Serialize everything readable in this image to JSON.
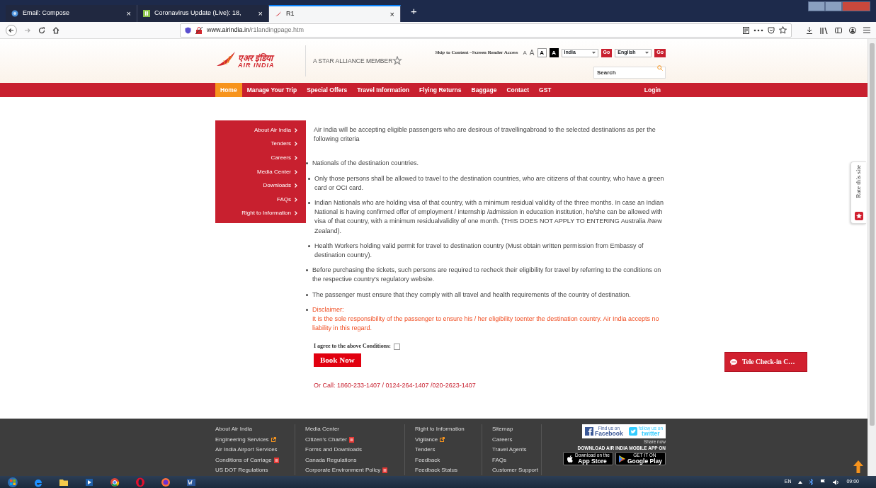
{
  "browser": {
    "tabs": [
      {
        "title": "Email: Compose",
        "kind": "globe",
        "close": "×",
        "selected": false
      },
      {
        "title": "Coronavirus Update (Live): 18,",
        "kind": "square",
        "close": "×",
        "selected": false
      },
      {
        "title": "R1",
        "kind": "plane",
        "close": "×",
        "selected": true
      }
    ],
    "new_tab": "+",
    "address": {
      "host": "www.airindia.in",
      "path": "/r1landingpage.htm"
    }
  },
  "header": {
    "logo_hindi": "एअर इंडिया",
    "logo_english": "AIR INDIA",
    "alliance": "A STAR ALLIANCE MEMBER",
    "skip": "Skip to Content –Screen Reader Access",
    "font_buttons": [
      {
        "label": "A",
        "kind": "plain"
      },
      {
        "label": "A",
        "kind": "large"
      },
      {
        "label": "A",
        "kind": "light"
      },
      {
        "label": "A",
        "kind": "dark"
      }
    ],
    "country": {
      "value": "India",
      "go": "Go"
    },
    "language": {
      "value": "English",
      "go": "Go"
    },
    "search": {
      "placeholder": "Search"
    }
  },
  "nav": {
    "items": [
      {
        "label": "Home",
        "selected": true
      },
      {
        "label": "Manage Your Trip",
        "selected": false
      },
      {
        "label": "Special Offers",
        "selected": false
      },
      {
        "label": "Travel Information",
        "selected": false
      },
      {
        "label": "Flying Returns",
        "selected": false
      },
      {
        "label": "Baggage",
        "selected": false
      },
      {
        "label": "Contact",
        "selected": false
      },
      {
        "label": "GST",
        "selected": false
      }
    ],
    "login": "Login"
  },
  "sidebar": {
    "items": [
      "About Air India",
      "Tenders",
      "Careers",
      "Media Center",
      "Downloads",
      "FAQs",
      "Right to Information"
    ]
  },
  "content": {
    "intro": "Air India will be accepting eligible passengers who are desirous of travellingabroad to the selected destinations as per the following criteria",
    "bullets": [
      {
        "kind": "normal",
        "text": "Nationals of the destination countries."
      },
      {
        "kind": "normal",
        "text": "Only those persons shall be allowed to travel to the destination countries, who are citizens of that country, who have a green card or OCI card."
      },
      {
        "kind": "normal",
        "text": "Indian Nationals who are holding visa of that country, with a minimum residual validity of the three months. In case an Indian National is having confirmed offer of employment / internship /admission in education institution, he/she can be allowed with visa of that country, with a minimum residualvalidity of one month. (THIS DOES NOT APPLY TO ENTERING Australia /New Zealand)."
      },
      {
        "kind": "normal",
        "text": "Health Workers holding valid permit for travel to destination country (Must obtain written permission from Embassy of destination country)."
      },
      {
        "kind": "normal",
        "text": "Before purchasing the tickets, such persons are required to recheck their eligibility for travel by referring to the conditions on the respective country's regulatory website."
      },
      {
        "kind": "normal",
        "text": "The passenger must ensure that they comply with all travel and health requirements of the country of destination."
      },
      {
        "kind": "disclaimer",
        "title": "Disclaimer:",
        "text": "It is the sole responsibility of the passenger to ensure his / her eligibility toenter the destination country. Air India accepts no liability in this regard."
      }
    ],
    "agree": {
      "label": "I agree to the above Conditions:",
      "checked": false
    },
    "book": "Book Now",
    "call": "Or Call: 1860-233-1407 / 0124-264-1407 /020-2623-1407"
  },
  "rate": "Rate this site",
  "tele": "Tele Check-in C…",
  "footer": {
    "columns": [
      [
        {
          "text": "About Air India",
          "kind": "plain"
        },
        {
          "text": "Engineering Services",
          "kind": "external"
        },
        {
          "text": "Air India Airport Services",
          "kind": "plain"
        },
        {
          "text": "Conditions of Carriage",
          "kind": "pdf"
        },
        {
          "text": "US DOT Regulations",
          "kind": "plain"
        }
      ],
      [
        {
          "text": "Media Center",
          "kind": "plain"
        },
        {
          "text": "Citizen's Charter",
          "kind": "pdf"
        },
        {
          "text": "Forms and Downloads",
          "kind": "plain"
        },
        {
          "text": "Canada Regulations",
          "kind": "plain"
        },
        {
          "text": "Corporate Environment Policy",
          "kind": "pdf"
        }
      ],
      [
        {
          "text": "Right to Information",
          "kind": "plain"
        },
        {
          "text": "Vigilance",
          "kind": "external"
        },
        {
          "text": "Tenders",
          "kind": "plain"
        },
        {
          "text": "Feedback",
          "kind": "plain"
        },
        {
          "text": "Feedback Status",
          "kind": "plain"
        }
      ],
      [
        {
          "text": "Sitemap"
        },
        {
          "text": "Careers"
        },
        {
          "text": "Travel Agents"
        },
        {
          "text": "FAQs"
        },
        {
          "text": "Customer Support"
        }
      ]
    ],
    "social": [
      {
        "kind": "facebook",
        "small": "Find us on",
        "big": "Facebook"
      },
      {
        "kind": "twitter",
        "small": "follow us on",
        "big": "twitter"
      }
    ],
    "share": "Share now",
    "download": "DOWNLOAD AIR INDIA MOBILE APP ON",
    "stores": [
      {
        "kind": "apple",
        "small": "Download on the",
        "big": "App Store"
      },
      {
        "kind": "google",
        "small": "GET IT ON",
        "big": "Google Play"
      }
    ]
  },
  "taskbar": {
    "language": "EN",
    "time": "09:00"
  }
}
